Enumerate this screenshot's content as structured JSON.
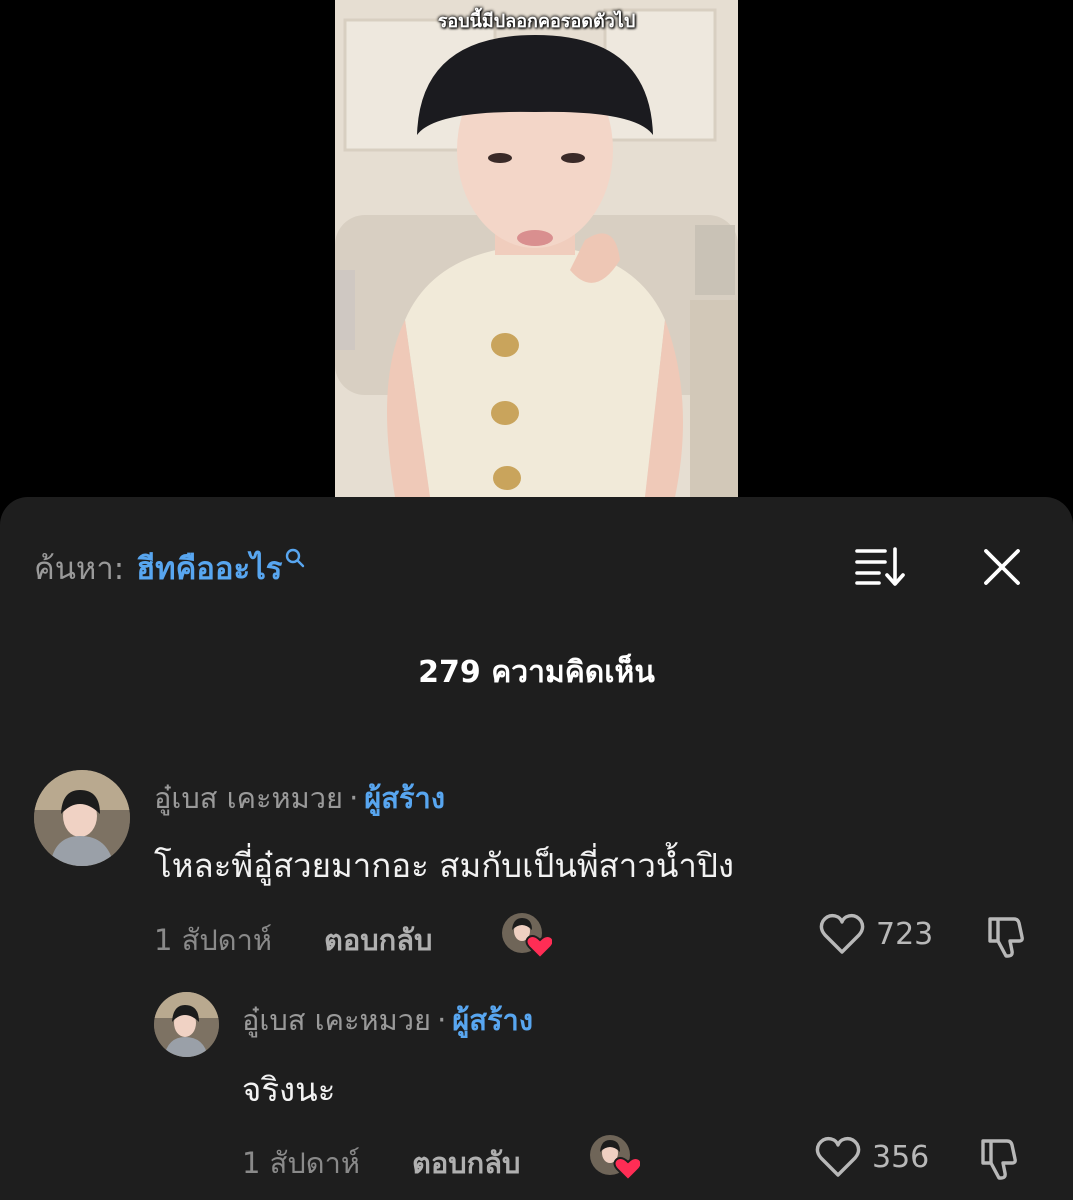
{
  "video": {
    "caption": "รอบนี้มีปลอกคอรอดตัวไป"
  },
  "search": {
    "prefix": "ค้นหา:",
    "term": "ฮีทคืออะไร"
  },
  "comments_count": "279 ความคิดเห็น",
  "comments": [
    {
      "author": "อู๋เบส เคะหมวย",
      "separator": "·",
      "badge": "ผู้สร้าง",
      "text": "โหละพี่อู๋สวยมากอะ สมกับเป็นพี่สาวน้ำปิง",
      "time": "1 สัปดาห์",
      "reply_label": "ตอบกลับ",
      "likes": "723"
    },
    {
      "author": "อู๋เบส เคะหมวย",
      "separator": "·",
      "badge": "ผู้สร้าง",
      "text": "จริงนะ",
      "time": "1 สัปดาห์",
      "reply_label": "ตอบกลับ",
      "likes": "356"
    }
  ],
  "colors": {
    "sheet_bg": "#1e1e1e",
    "accent": "#58a6f0",
    "creator_heart": "#ff2d55"
  },
  "icons": [
    "search-icon",
    "sort-icon",
    "close-icon",
    "heart-icon",
    "dislike-icon"
  ]
}
